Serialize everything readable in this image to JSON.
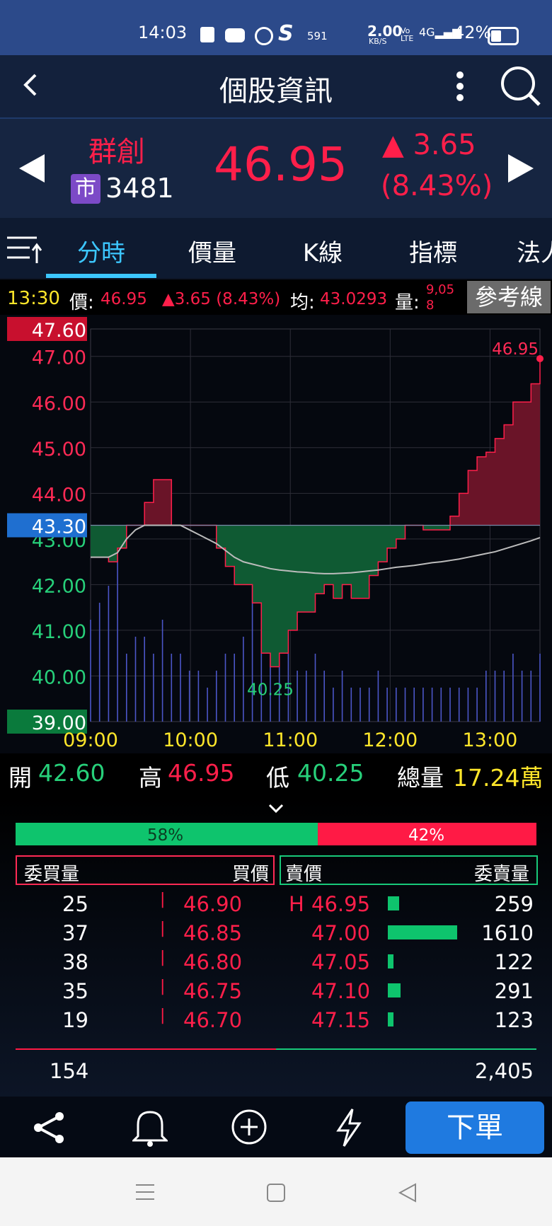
{
  "status_bar": {
    "time": "14:03",
    "net_speed": "2.00",
    "net_unit": "KB/S",
    "volte": "Vo LTE",
    "signal": "4G",
    "battery": "42%",
    "notif_num": "591"
  },
  "header": {
    "title": "個股資訊"
  },
  "stock": {
    "name": "群創",
    "market_badge": "市",
    "code": "3481",
    "price": "46.95",
    "change": "▲ 3.65",
    "change_pct": "(8.43%)"
  },
  "tabs": [
    "分時",
    "價量",
    "K線",
    "指標",
    "法人"
  ],
  "info_bar": {
    "time": "13:30",
    "price_label": "價:",
    "price": "46.95",
    "change": "▲3.65 (8.43%)",
    "avg_label": "均:",
    "avg": "43.0293",
    "vol_label": "量:",
    "vol_top": "9,05",
    "vol_bottom": "8",
    "ref_button": "參考線"
  },
  "chart_data": {
    "type": "line",
    "x_ticks": [
      "09:00",
      "10:00",
      "11:00",
      "12:00",
      "13:00"
    ],
    "y_ticks": [
      "47.00",
      "46.00",
      "45.00",
      "44.00",
      "43.00",
      "42.00",
      "41.00",
      "40.00"
    ],
    "y_max_label": "47.60",
    "y_min_label": "39.00",
    "reference_label": "43.30",
    "reference": 43.3,
    "ylim": [
      39.0,
      47.6
    ],
    "high_annotation": "46.95",
    "low_annotation": "40.25",
    "price": [
      42.6,
      42.6,
      42.5,
      42.8,
      43.3,
      43.3,
      43.8,
      44.3,
      44.3,
      43.3,
      43.3,
      43.3,
      43.3,
      43.3,
      42.8,
      42.4,
      42.0,
      42.0,
      41.6,
      40.5,
      40.2,
      40.5,
      41.0,
      41.4,
      41.4,
      41.8,
      42.0,
      41.7,
      42.0,
      41.7,
      41.7,
      42.2,
      42.5,
      42.8,
      43.0,
      43.3,
      43.3,
      43.2,
      43.2,
      43.2,
      43.5,
      44.0,
      44.5,
      44.8,
      44.9,
      45.2,
      45.5,
      46.0,
      46.0,
      46.4,
      46.95
    ],
    "avg": [
      42.6,
      42.6,
      42.6,
      42.7,
      43.0,
      43.2,
      43.3,
      43.3,
      43.3,
      43.3,
      43.3,
      43.2,
      43.1,
      43.0,
      42.9,
      42.75,
      42.6,
      42.5,
      42.45,
      42.4,
      42.35,
      42.32,
      42.3,
      42.28,
      42.27,
      42.25,
      42.24,
      42.24,
      42.25,
      42.26,
      42.28,
      42.3,
      42.32,
      42.35,
      42.38,
      42.4,
      42.42,
      42.45,
      42.48,
      42.5,
      42.53,
      42.56,
      42.6,
      42.64,
      42.68,
      42.72,
      42.78,
      42.84,
      42.9,
      42.96,
      43.03
    ],
    "volume": [
      0.6,
      0.7,
      0.8,
      1.0,
      0.4,
      0.5,
      0.5,
      0.4,
      0.6,
      0.4,
      0.4,
      0.3,
      0.3,
      0.2,
      0.3,
      0.4,
      0.4,
      0.5,
      0.8,
      1.0,
      0.9,
      0.5,
      0.4,
      0.3,
      0.3,
      0.4,
      0.3,
      0.2,
      0.3,
      0.2,
      0.2,
      0.2,
      0.3,
      0.2,
      0.2,
      0.2,
      0.2,
      0.2,
      0.2,
      0.2,
      0.2,
      0.2,
      0.2,
      0.2,
      0.3,
      0.3,
      0.3,
      0.4,
      0.3,
      0.3,
      0.4
    ]
  },
  "ohlc": {
    "open_label": "開",
    "open": "42.60",
    "high_label": "高",
    "high": "46.95",
    "low_label": "低",
    "low": "40.25",
    "vol_label": "總量",
    "vol": "17.24萬"
  },
  "ratio": {
    "buy": "58%",
    "sell": "42%",
    "buy_fraction": 0.58
  },
  "orderbook": {
    "headers": {
      "bid_qty": "委買量",
      "bid_price": "買價",
      "ask_price": "賣價",
      "ask_qty": "委賣量"
    },
    "rows": [
      {
        "bid_qty": "25",
        "bid_price": "46.90",
        "ask_flag": "H",
        "ask_price": "46.95",
        "ask_qty": "259",
        "ask_bar": 0.16
      },
      {
        "bid_qty": "37",
        "bid_price": "46.85",
        "ask_flag": "",
        "ask_price": "47.00",
        "ask_qty": "1610",
        "ask_bar": 1.0
      },
      {
        "bid_qty": "38",
        "bid_price": "46.80",
        "ask_flag": "",
        "ask_price": "47.05",
        "ask_qty": "122",
        "ask_bar": 0.08
      },
      {
        "bid_qty": "35",
        "bid_price": "46.75",
        "ask_flag": "",
        "ask_price": "47.10",
        "ask_qty": "291",
        "ask_bar": 0.18
      },
      {
        "bid_qty": "19",
        "bid_price": "46.70",
        "ask_flag": "",
        "ask_price": "47.15",
        "ask_qty": "123",
        "ask_bar": 0.08
      }
    ],
    "bid_total": "154",
    "ask_total": "2,405"
  },
  "bottom_nav": {
    "order_button": "下單",
    "icons": [
      "share-icon",
      "bell-icon",
      "plus-circle-icon",
      "lightning-icon"
    ]
  }
}
